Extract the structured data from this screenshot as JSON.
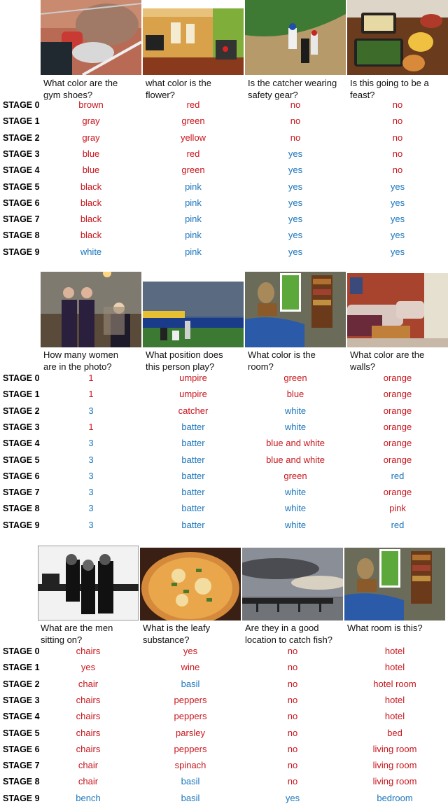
{
  "colors": {
    "wrong": "#c8161d",
    "correct": "#1b75bc"
  },
  "stage_labels": [
    "STAGE 0",
    "STAGE 1",
    "STAGE 2",
    "STAGE 3",
    "STAGE 4",
    "STAGE 5",
    "STAGE 6",
    "STAGE 7",
    "STAGE 8",
    "STAGE 9"
  ],
  "blocks": [
    {
      "columns": [
        {
          "image": "gym-shoes-in-basket-photo",
          "question": [
            "What color are the",
            "gym shoes?"
          ],
          "answers": [
            "brown",
            "gray",
            "gray",
            "blue",
            "blue",
            "black",
            "black",
            "black",
            "black",
            "white"
          ],
          "correct": [
            false,
            false,
            false,
            false,
            false,
            false,
            false,
            false,
            false,
            true
          ]
        },
        {
          "image": "living-room-with-flower-photo",
          "question": [
            "what color is the",
            "flower?"
          ],
          "answers": [
            "red",
            "green",
            "yellow",
            "red",
            "green",
            "pink",
            "pink",
            "pink",
            "pink",
            "pink"
          ],
          "correct": [
            false,
            false,
            false,
            false,
            false,
            true,
            true,
            true,
            true,
            true
          ]
        },
        {
          "image": "baseball-catcher-photo",
          "question": [
            "Is the catcher wearing",
            "safety gear?"
          ],
          "answers": [
            "no",
            "no",
            "no",
            "yes",
            "yes",
            "yes",
            "yes",
            "yes",
            "yes",
            "yes"
          ],
          "correct": [
            false,
            false,
            false,
            true,
            true,
            true,
            true,
            true,
            true,
            true
          ]
        },
        {
          "image": "feast-food-table-photo",
          "question": [
            "Is this going to be a",
            "feast?"
          ],
          "answers": [
            "no",
            "no",
            "no",
            "no",
            "no",
            "yes",
            "yes",
            "yes",
            "yes",
            "yes"
          ],
          "correct": [
            false,
            false,
            false,
            false,
            false,
            true,
            true,
            true,
            true,
            true
          ]
        }
      ]
    },
    {
      "columns": [
        {
          "image": "three-women-photo",
          "question": [
            "How many women",
            "are in the photo?"
          ],
          "answers": [
            "1",
            "1",
            "3",
            "1",
            "3",
            "3",
            "3",
            "3",
            "3",
            "3"
          ],
          "correct": [
            false,
            false,
            true,
            false,
            true,
            true,
            true,
            true,
            true,
            true
          ]
        },
        {
          "image": "baseball-batter-stadium-photo",
          "question": [
            "What position does",
            "this person play?"
          ],
          "answers": [
            "umpire",
            "umpire",
            "catcher",
            "batter",
            "batter",
            "batter",
            "batter",
            "batter",
            "batter",
            "batter"
          ],
          "correct": [
            false,
            false,
            false,
            true,
            true,
            true,
            true,
            true,
            true,
            true
          ]
        },
        {
          "image": "bedroom-photo",
          "question": [
            "What color is the",
            "room?"
          ],
          "answers": [
            "green",
            "blue",
            "white",
            "white",
            "blue and white",
            "blue and white",
            "green",
            "white",
            "white",
            "white"
          ],
          "correct": [
            false,
            false,
            true,
            true,
            false,
            false,
            false,
            true,
            true,
            true
          ]
        },
        {
          "image": "living-room-red-walls-photo",
          "question": [
            "What color are the",
            "walls?"
          ],
          "answers": [
            "orange",
            "orange",
            "orange",
            "orange",
            "orange",
            "orange",
            "red",
            "orange",
            "pink",
            "red"
          ],
          "correct": [
            false,
            false,
            false,
            false,
            false,
            false,
            true,
            false,
            false,
            true
          ]
        }
      ]
    },
    {
      "columns": [
        {
          "image": "men-on-bench-bw-photo",
          "question": [
            "What are the men",
            "sitting on?"
          ],
          "answers": [
            "chairs",
            "yes",
            "chair",
            "chairs",
            "chairs",
            "chairs",
            "chairs",
            "chair",
            "chair",
            "bench"
          ],
          "correct": [
            false,
            false,
            false,
            false,
            false,
            false,
            false,
            false,
            false,
            true
          ]
        },
        {
          "image": "pizza-with-basil-photo",
          "question": [
            "What is the leafy",
            "substance?"
          ],
          "answers": [
            "yes",
            "wine",
            "basil",
            "peppers",
            "peppers",
            "parsley",
            "peppers",
            "spinach",
            "basil",
            "basil"
          ],
          "correct": [
            false,
            false,
            true,
            false,
            false,
            false,
            false,
            false,
            true,
            true
          ]
        },
        {
          "image": "pier-at-sunset-photo",
          "question": [
            "Are they in a good",
            "location to catch fish?"
          ],
          "answers": [
            "no",
            "no",
            "no",
            "no",
            "no",
            "no",
            "no",
            "no",
            "no",
            "yes"
          ],
          "correct": [
            false,
            false,
            false,
            false,
            false,
            false,
            false,
            false,
            false,
            true
          ]
        },
        {
          "image": "bedroom-photo",
          "question": [
            "What room is this?",
            ""
          ],
          "answers": [
            "hotel",
            "hotel",
            "hotel room",
            "hotel",
            "hotel",
            "bed",
            "living room",
            "living room",
            "living room",
            "bedroom"
          ],
          "correct": [
            false,
            false,
            false,
            false,
            false,
            false,
            false,
            false,
            false,
            true
          ]
        }
      ]
    }
  ]
}
